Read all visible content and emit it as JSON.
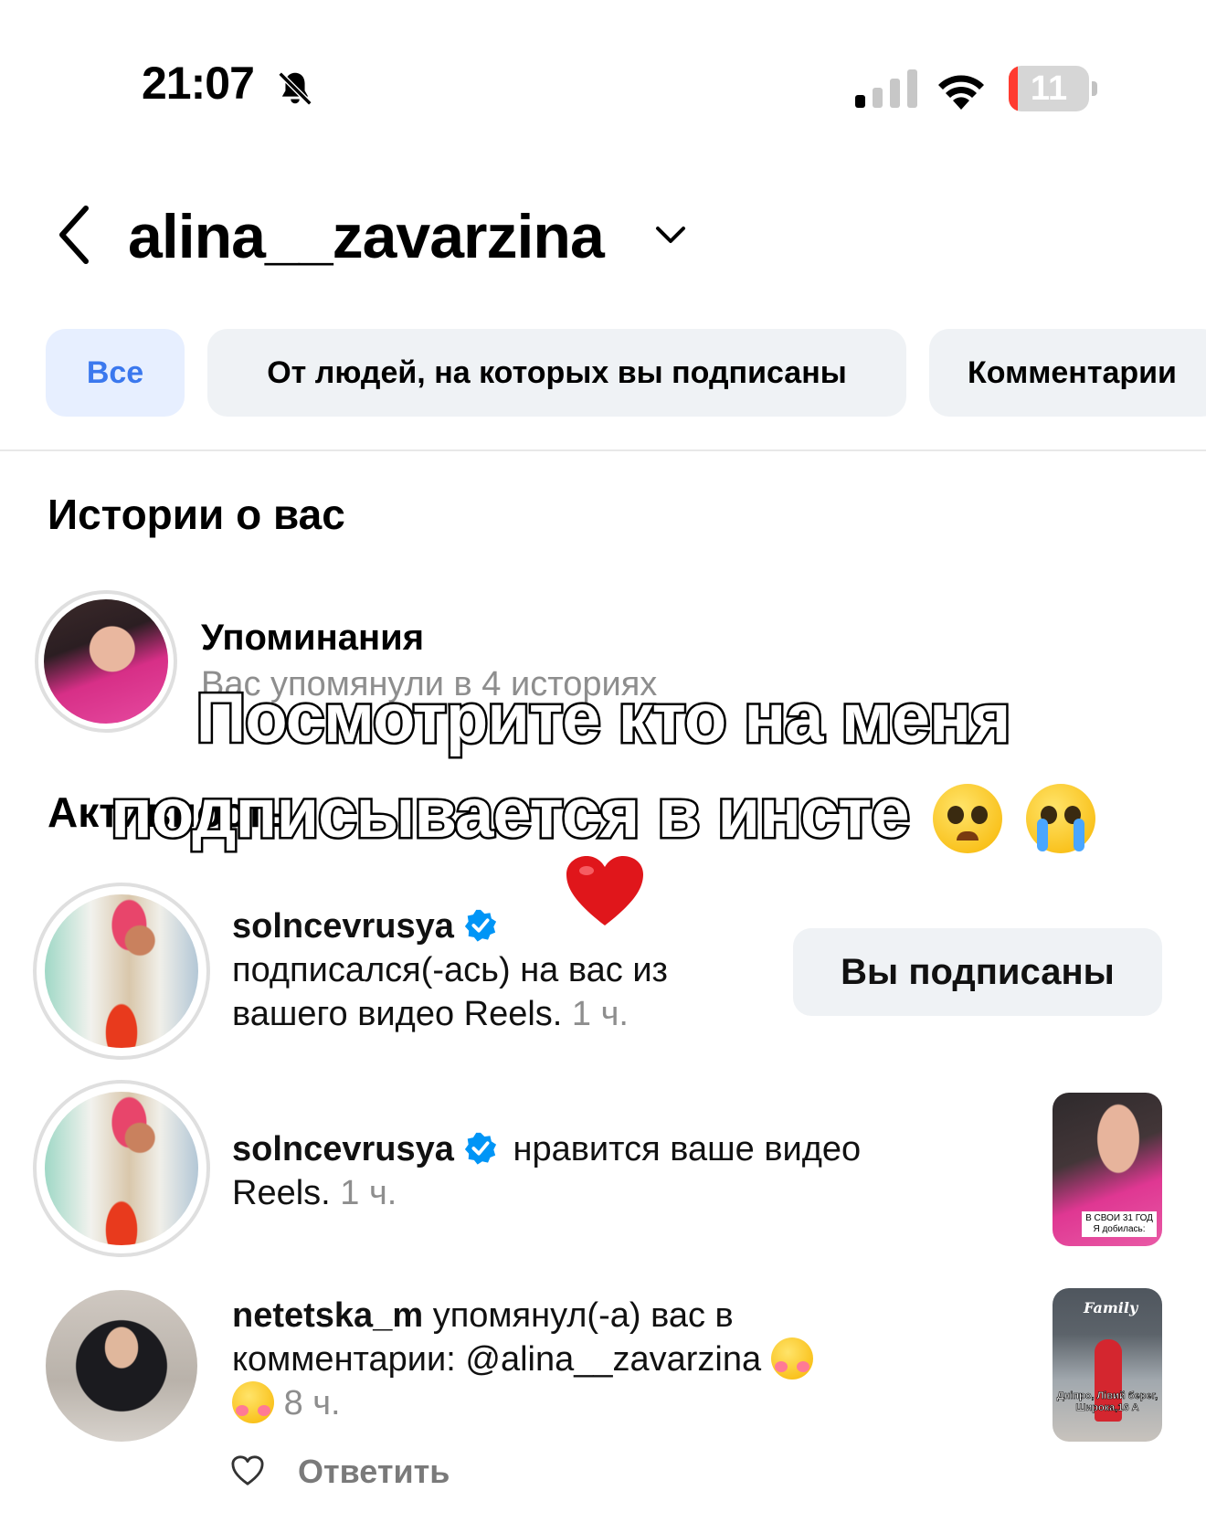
{
  "status_bar": {
    "time": "21:07",
    "battery_level": "11",
    "icons": [
      "bell-slash-icon",
      "cellular-signal-icon",
      "wifi-icon",
      "battery-icon"
    ]
  },
  "header": {
    "username": "alina__zavarzina",
    "icons": [
      "back-chevron-icon",
      "chevron-down-icon"
    ]
  },
  "tabs": [
    {
      "label": "Все",
      "active": true
    },
    {
      "label": "От людей, на которых вы подписаны",
      "active": false
    },
    {
      "label": "Комментарии",
      "active": false
    }
  ],
  "stories_section": {
    "title": "Истории о вас",
    "mentions": {
      "title": "Упоминания",
      "subtitle": "Вас упомянули в 4 историях"
    }
  },
  "activity_section": {
    "title": "Активность"
  },
  "overlay_caption": {
    "line1": "Посмотрите кто на меня",
    "line2": "подписывается в инсте",
    "emojis": [
      "pleading-face-emoji",
      "loudly-crying-face-emoji",
      "red-heart-emoji"
    ]
  },
  "notifications": [
    {
      "username": "solncevrusya",
      "verified": true,
      "text": "подписался(-ась) на вас из вашего видео Reels.",
      "time": "1 ч.",
      "button_label": "Вы подписаны"
    },
    {
      "username": "solncevrusya",
      "verified": true,
      "text": "нравится ваше видео Reels.",
      "time": "1 ч.",
      "thumbnail_caption": "В СВОИ 31 ГОД Я добилась:"
    },
    {
      "username": "netetska_m",
      "verified": false,
      "text": "упомянул(-а) вас в комментарии: @alina__zavarzina",
      "time": "8 ч.",
      "reply_label": "Ответить",
      "thumbnail_brand": "Family",
      "thumbnail_caption": "Дніпро, Лівий берег, Широка,16 А"
    }
  ],
  "colors": {
    "accent": "#3b78ee",
    "verified": "#0095f6",
    "secondary_text": "#8e8e8e",
    "chip_bg": "#eff2f5",
    "active_chip_bg": "#e7efff",
    "battery_low": "#ff3b30",
    "heart": "#e0161b"
  }
}
